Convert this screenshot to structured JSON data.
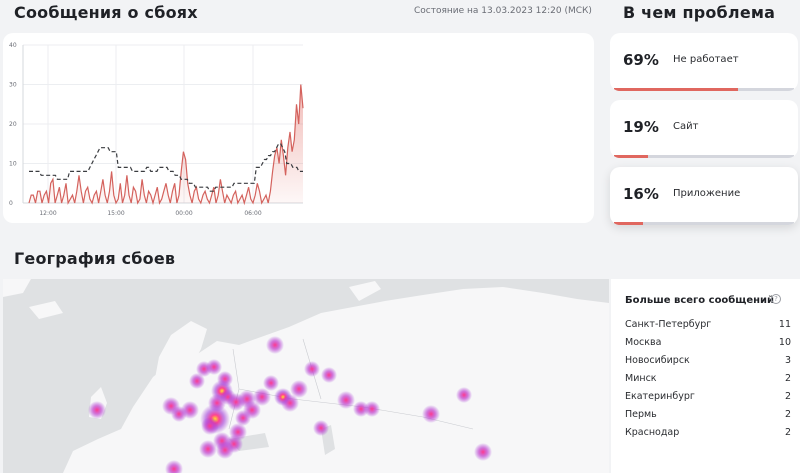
{
  "reports": {
    "title": "Сообщения о сбоях",
    "status": "Состояние на 13.03.2023 12:20 (МСК)"
  },
  "chart_data": {
    "type": "line",
    "x_ticks": [
      "12:00",
      "15:00",
      "00:00",
      "06:00"
    ],
    "y_ticks": [
      0,
      10,
      20,
      30,
      40
    ],
    "ylim": [
      0,
      40
    ],
    "grid": true,
    "series": [
      {
        "style": "area-solid",
        "color": "#d4625d",
        "values": [
          0,
          2,
          2,
          0,
          3,
          3,
          0,
          2,
          3,
          0,
          5,
          6,
          0,
          2,
          4,
          0,
          2,
          5,
          0,
          1,
          2,
          0,
          3,
          7,
          3,
          0,
          3,
          4,
          1,
          0,
          2,
          3,
          0,
          3,
          6,
          2,
          0,
          3,
          8,
          2,
          0,
          1,
          5,
          0,
          2,
          7,
          2,
          0,
          4,
          3,
          0,
          1,
          6,
          2,
          0,
          3,
          2,
          0,
          2,
          4,
          0,
          1,
          3,
          5,
          2,
          0,
          3,
          5,
          0,
          2,
          8,
          13,
          11,
          5,
          2,
          0,
          3,
          4,
          1,
          0,
          2,
          3,
          1,
          0,
          2,
          4,
          0,
          2,
          6,
          3,
          0,
          2,
          1,
          0,
          2,
          3,
          0,
          1,
          2,
          0,
          2,
          4,
          1,
          0,
          2,
          5,
          3,
          0,
          1,
          2,
          0,
          3,
          8,
          12,
          14,
          10,
          16,
          12,
          7,
          14,
          18,
          13,
          16,
          25,
          20,
          30,
          24
        ]
      },
      {
        "style": "dashed",
        "color": "#3a3c40",
        "values": [
          8,
          8,
          8,
          8,
          8,
          8,
          7,
          7,
          7,
          7,
          7,
          7,
          7,
          7,
          6,
          6,
          6,
          6,
          6,
          6,
          8,
          8,
          8,
          8,
          8,
          8,
          8,
          8,
          8,
          8,
          9,
          10,
          11,
          12,
          13,
          14,
          14,
          14,
          14,
          14,
          13,
          13,
          13,
          13,
          9,
          9,
          9,
          9,
          9,
          9,
          9,
          8,
          8,
          8,
          8,
          8,
          8,
          8,
          9,
          9,
          8,
          8,
          8,
          8,
          9,
          9,
          9,
          9,
          9,
          8,
          8,
          8,
          7,
          7,
          7,
          6,
          6,
          6,
          6,
          5,
          5,
          5,
          4,
          4,
          4,
          4,
          4,
          4,
          4,
          3,
          3,
          3,
          4,
          4,
          4,
          4,
          4,
          4,
          4,
          4,
          4,
          5,
          5,
          5,
          5,
          5,
          5,
          5,
          5,
          5,
          5,
          5,
          9,
          9,
          9,
          10,
          11,
          11,
          12,
          12,
          13,
          13,
          14,
          15,
          15,
          14,
          13,
          10,
          10,
          10,
          9,
          9,
          9,
          8,
          8,
          8
        ]
      }
    ]
  },
  "problem": {
    "title": "В чем проблема",
    "items": [
      {
        "pct": "69%",
        "label": "Не работает",
        "value": 0.69,
        "active": false
      },
      {
        "pct": "19%",
        "label": "Сайт",
        "value": 0.19,
        "active": false
      },
      {
        "pct": "16%",
        "label": "Приложение",
        "value": 0.16,
        "active": true
      }
    ]
  },
  "geo": {
    "title": "География сбоев",
    "top_title": "Больше всего сообщений",
    "cities": [
      {
        "name": "Санкт-Петербург",
        "count": "11"
      },
      {
        "name": "Москва",
        "count": "10"
      },
      {
        "name": "Новосибирск",
        "count": "3"
      },
      {
        "name": "Минск",
        "count": "2"
      },
      {
        "name": "Екатеринбург",
        "count": "2"
      },
      {
        "name": "Пермь",
        "count": "2"
      },
      {
        "name": "Краснодар",
        "count": "2"
      }
    ]
  },
  "colors": {
    "accent": "#e0675f",
    "track": "#d4d6dd",
    "heat_outer": "#9b2dd6",
    "heat_mid": "#ff3a8c",
    "heat_core": "#ffe22a"
  }
}
